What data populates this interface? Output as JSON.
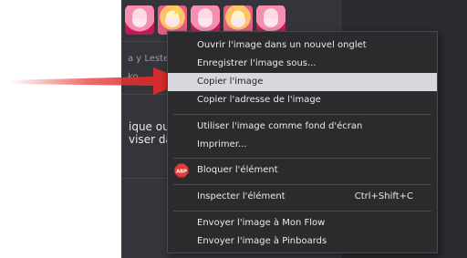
{
  "page": {
    "bg_color": "#2b2b2f",
    "text_partials": [
      "ique ou d'u",
      "viser dans"
    ],
    "faded_text": "a y Leste",
    "faded_text_2": "ko"
  },
  "context_menu": {
    "items": [
      {
        "label": "Ouvrir l'image dans un nouvel onglet"
      },
      {
        "label": "Enregistrer l'image sous..."
      },
      {
        "label": "Copier l'image",
        "highlighted": true
      },
      {
        "label": "Copier l'adresse de l'image"
      },
      {
        "label": "Utiliser l'image comme fond d'écran"
      },
      {
        "label": "Imprimer..."
      },
      {
        "label": "Bloquer l'élément",
        "icon": "adblock-plus-icon",
        "icon_text": "ABP"
      },
      {
        "label": "Inspecter l'élément",
        "shortcut": "Ctrl+Shift+C"
      },
      {
        "label": "Envoyer l'image à Mon Flow"
      },
      {
        "label": "Envoyer l'image à Pinboards"
      }
    ],
    "highlight_color": "#d7d8dd"
  },
  "arrow": {
    "color": "#e53935",
    "icon": "red-arrow-pointer"
  }
}
